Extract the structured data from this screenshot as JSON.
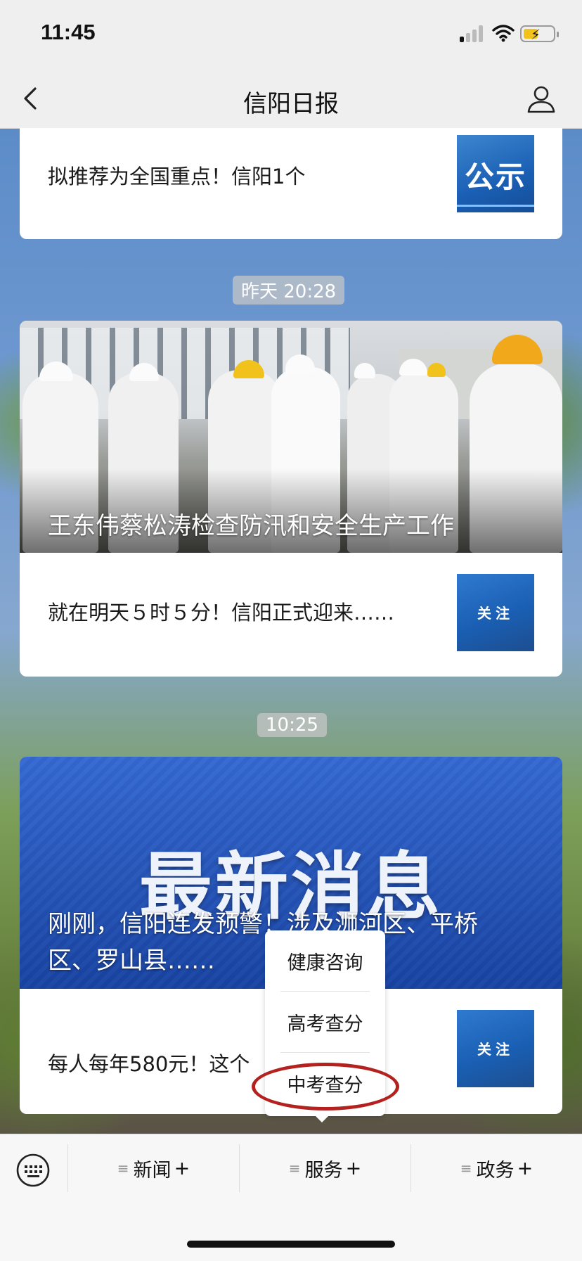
{
  "status_bar": {
    "time": "11:45"
  },
  "navbar": {
    "title": "信阳日报"
  },
  "articles": [
    {
      "title": "拟推荐为全国重点！信阳1个",
      "thumb_text": "公示"
    },
    {
      "timestamp": "昨天 20:28",
      "hero_title": "王东伟蔡松涛检查防汛和安全生产工作",
      "sub_title": "就在明天５时５分！信阳正式迎来……",
      "thumb_text": "关注"
    },
    {
      "timestamp": "10:25",
      "hero_banner": "最新消息",
      "hero_title_line1": "刚刚，信阳连发预警！涉及浉河区、平桥",
      "hero_title_line2": "区、罗山县……",
      "sub_title": "每人每年580元！这个",
      "thumb_text": "关注"
    }
  ],
  "popup_menu": {
    "items": [
      "健康咨询",
      "高考查分",
      "中考查分"
    ]
  },
  "tabbar": {
    "tabs": [
      {
        "label": "新闻",
        "suffix": "+"
      },
      {
        "label": "服务",
        "suffix": "+"
      },
      {
        "label": "政务",
        "suffix": "+"
      }
    ]
  },
  "colors": {
    "highlight": "#b3221e",
    "battery": "#f3c21a",
    "thumb_blue": "#1a5fb4"
  }
}
